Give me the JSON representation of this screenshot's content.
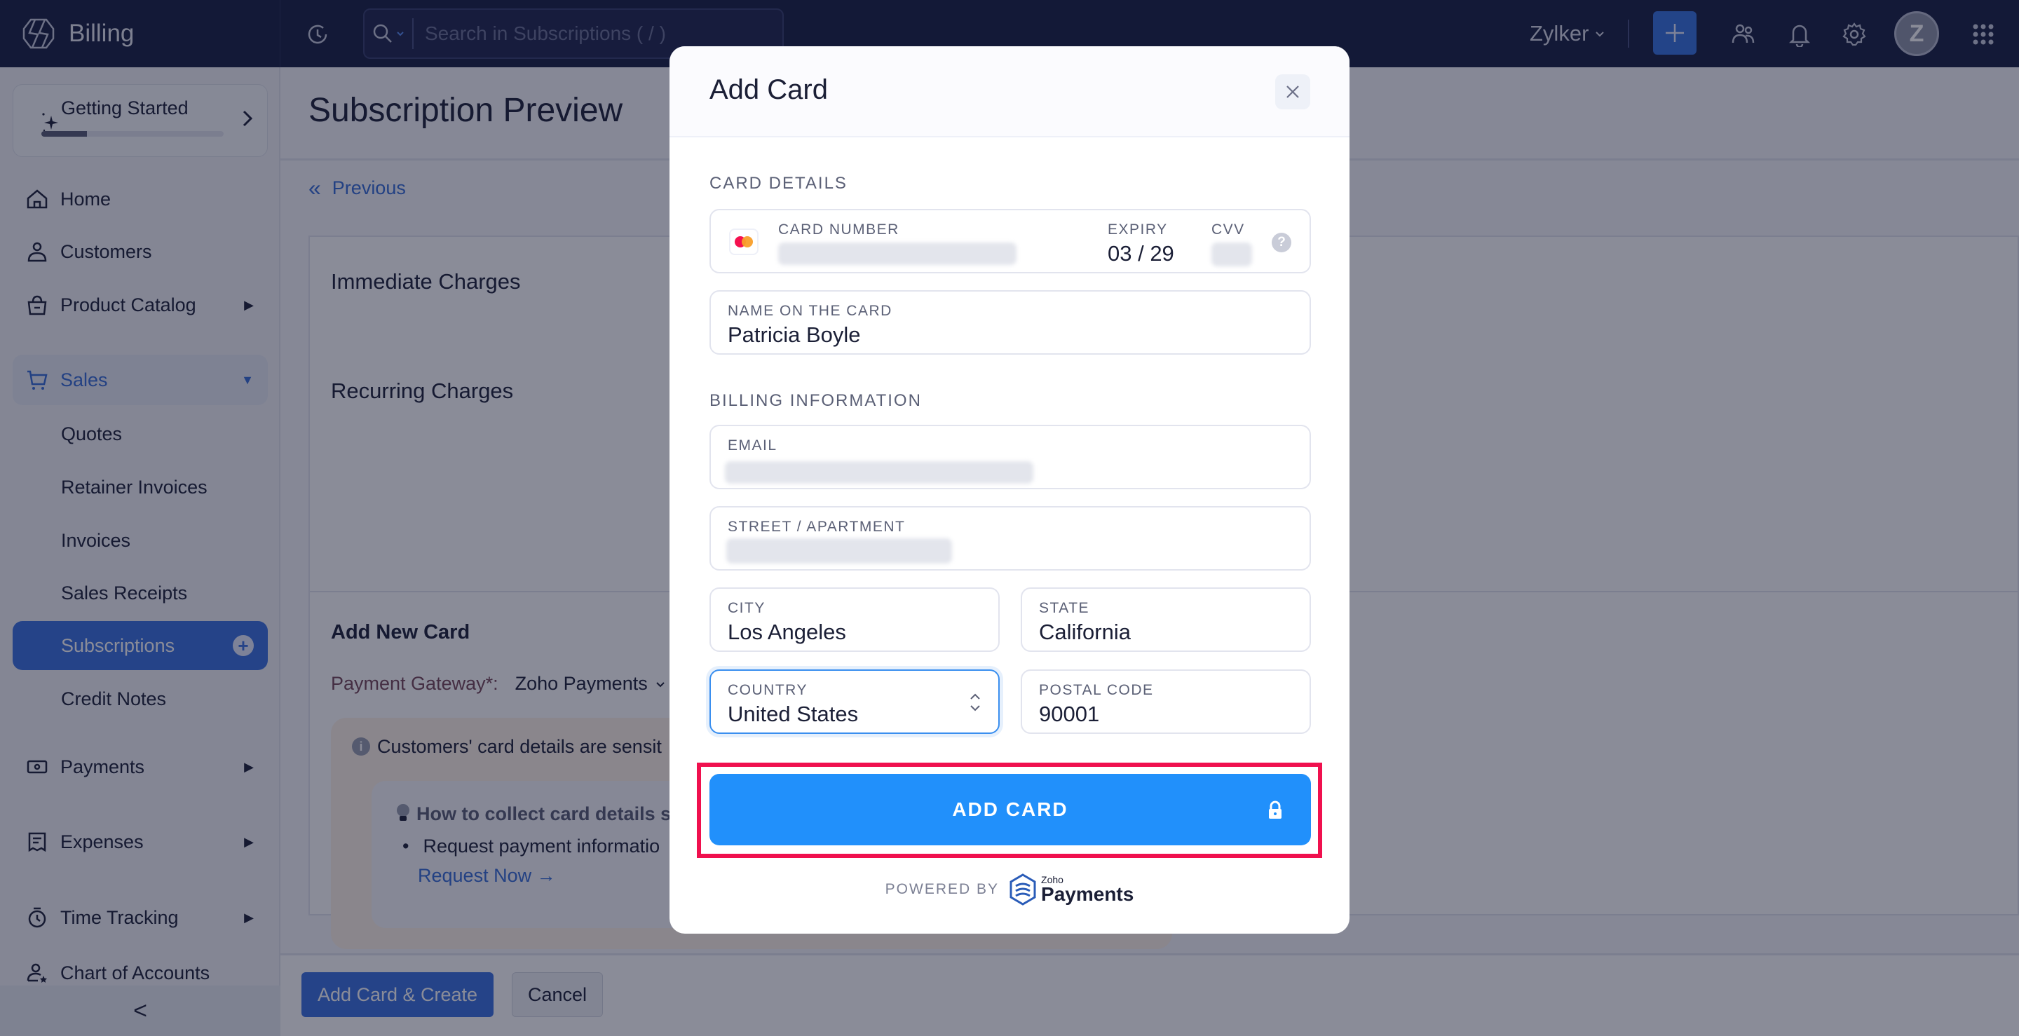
{
  "topbar": {
    "app_name": "Billing",
    "search_placeholder": "Search in Subscriptions ( / )",
    "org_name": "Zylker",
    "avatar_initial": "Z"
  },
  "sidebar": {
    "getting_started": {
      "label": "Getting Started",
      "progress": 0.25
    },
    "items": [
      {
        "label": "Home",
        "icon": "home-icon"
      },
      {
        "label": "Customers",
        "icon": "user-icon"
      },
      {
        "label": "Product Catalog",
        "icon": "bag-icon",
        "has_submenu": true
      },
      {
        "label": "Sales",
        "icon": "cart-icon",
        "expanded": true
      },
      {
        "label": "Payments",
        "icon": "money-icon",
        "has_submenu": true
      },
      {
        "label": "Expenses",
        "icon": "receipt-icon",
        "has_submenu": true
      },
      {
        "label": "Time Tracking",
        "icon": "stopwatch-icon",
        "has_submenu": true
      },
      {
        "label": "Chart of Accounts",
        "icon": "accounts-icon"
      }
    ],
    "sales_subitems": [
      {
        "label": "Quotes"
      },
      {
        "label": "Retainer Invoices"
      },
      {
        "label": "Invoices"
      },
      {
        "label": "Sales Receipts"
      },
      {
        "label": "Subscriptions",
        "active": true
      },
      {
        "label": "Credit Notes"
      }
    ],
    "collapse_glyph": "<"
  },
  "main": {
    "page_title": "Subscription Preview",
    "previous_label": "Previous",
    "immediate_charges": "Immediate Charges",
    "recurring_charges": "Recurring Charges",
    "add_new_card_title": "Add New Card",
    "payment_gateway_label": "Payment Gateway*:",
    "payment_gateway_value": "Zoho Payments",
    "info_text": "Customers' card details are sensit",
    "tip_title": "How to collect card details s",
    "tip_bullet": "Request payment informatio",
    "tip_link": "Request Now →",
    "footer": {
      "primary_label": "Add Card & Create",
      "cancel_label": "Cancel"
    }
  },
  "modal": {
    "title": "Add Card",
    "card_details_section": "CARD DETAILS",
    "card_number_label": "CARD NUMBER",
    "expiry_label": "EXPIRY",
    "expiry_value": "03 / 29",
    "cvv_label": "CVV",
    "name_label": "NAME ON THE CARD",
    "name_value": "Patricia Boyle",
    "billing_section": "BILLING INFORMATION",
    "email_label": "EMAIL",
    "street_label": "STREET / APARTMENT",
    "city_label": "CITY",
    "city_value": "Los Angeles",
    "state_label": "STATE",
    "state_value": "California",
    "country_label": "COUNTRY",
    "country_value": "United States",
    "postal_label": "POSTAL CODE",
    "postal_value": "90001",
    "add_card_label": "ADD CARD",
    "powered_by": "POWERED BY",
    "brand_small": "Zoho",
    "brand_big": "Payments"
  },
  "colors": {
    "accent": "#3f74e0",
    "add_card_button": "#2190fb",
    "highlight": "#f0104e",
    "topbar": "#1c2345"
  }
}
